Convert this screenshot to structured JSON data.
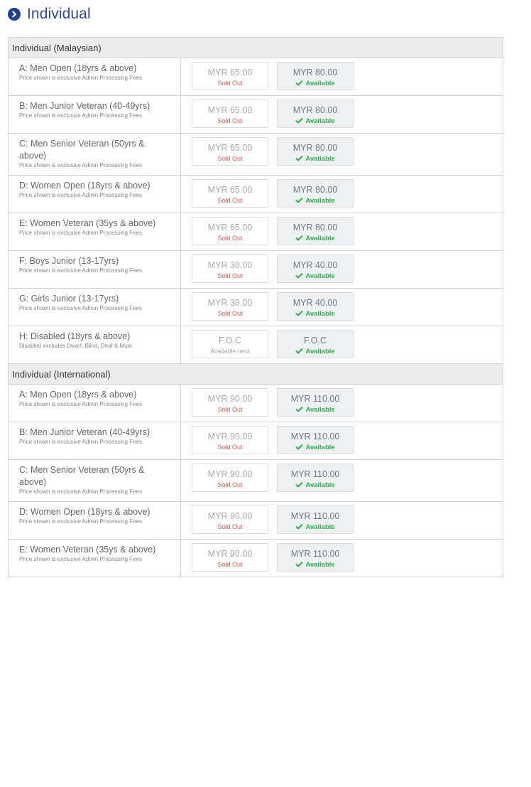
{
  "section": {
    "title": "Individual",
    "icon": "chevron-right-circle-icon"
  },
  "colors": {
    "accent": "#2a4aa0",
    "sold_out": "#e05a4a",
    "available": "#2bb24c"
  },
  "groups": [
    {
      "title": "Individual (Malaysian)",
      "rows": [
        {
          "name": "A: Men Open (18yrs & above)",
          "note": "Price shown is exclusive Admin Processing Fees",
          "early_price": "MYR 65.00",
          "early_status": "Sold Out",
          "regular_price": "MYR 80.00",
          "regular_status": "Available"
        },
        {
          "name": "B: Men Junior Veteran (40-49yrs)",
          "note": "Price shown is exclusive Admin Processing Fees",
          "early_price": "MYR 65.00",
          "early_status": "Sold Out",
          "regular_price": "MYR 80.00",
          "regular_status": "Available"
        },
        {
          "name": "C: Men Senior Veteran (50yrs & above)",
          "note": "Price shown is exclusive Admin Processing Fees",
          "early_price": "MYR 65.00",
          "early_status": "Sold Out",
          "regular_price": "MYR 80.00",
          "regular_status": "Available"
        },
        {
          "name": "D: Women Open (18yrs & above)",
          "note": "Price shown is exclusive Admin Processing Fees",
          "early_price": "MYR 65.00",
          "early_status": "Sold Out",
          "regular_price": "MYR 80.00",
          "regular_status": "Available"
        },
        {
          "name": "E: Women Veteran (35ys & above)",
          "note": "Price shown is exclusive Admin Processing Fees",
          "early_price": "MYR 65.00",
          "early_status": "Sold Out",
          "regular_price": "MYR 80.00",
          "regular_status": "Available"
        },
        {
          "name": "F: Boys Junior (13-17yrs)",
          "note": "Price shown is exclusive Admin Processing Fees",
          "early_price": "MYR 30.00",
          "early_status": "Sold Out",
          "regular_price": "MYR 40.00",
          "regular_status": "Available"
        },
        {
          "name": "G: Girls Junior (13-17yrs)",
          "note": "Price shown is exclusive Admin Processing Fees",
          "early_price": "MYR 30.00",
          "early_status": "Sold Out",
          "regular_price": "MYR 40.00",
          "regular_status": "Available"
        },
        {
          "name": "H: Disabled (18yrs & above)",
          "note": "Disabled excludes Dwarf, Blind, Deaf & Mute",
          "early_price": "F.O.C",
          "early_status": "Available next",
          "regular_price": "F.O.C",
          "regular_status": "Available"
        }
      ]
    },
    {
      "title": "Individual (International)",
      "rows": [
        {
          "name": "A: Men Open (18yrs & above)",
          "note": "Price shown is exclusive Admin Processing Fees",
          "early_price": "MYR 90.00",
          "early_status": "Sold Out",
          "regular_price": "MYR 110.00",
          "regular_status": "Available"
        },
        {
          "name": "B: Men Junior Veteran (40-49yrs)",
          "note": "Price shown is exclusive Admin Processing Fees",
          "early_price": "MYR 90.00",
          "early_status": "Sold Out",
          "regular_price": "MYR 110.00",
          "regular_status": "Available"
        },
        {
          "name": "C: Men Senior Veteran (50yrs & above)",
          "note": "Price shown is exclusive Admin Processing Fees",
          "early_price": "MYR 90.00",
          "early_status": "Sold Out",
          "regular_price": "MYR 110.00",
          "regular_status": "Available"
        },
        {
          "name": "D: Women Open (18yrs & above)",
          "note": "Price shown is exclusive Admin Processing Fees",
          "early_price": "MYR 90.00",
          "early_status": "Sold Out",
          "regular_price": "MYR 110.00",
          "regular_status": "Available"
        },
        {
          "name": "E: Women Veteran (35ys & above)",
          "note": "Price shown is exclusive Admin Processing Fees",
          "early_price": "MYR 90.00",
          "early_status": "Sold Out",
          "regular_price": "MYR 110.00",
          "regular_status": "Available"
        }
      ]
    }
  ]
}
